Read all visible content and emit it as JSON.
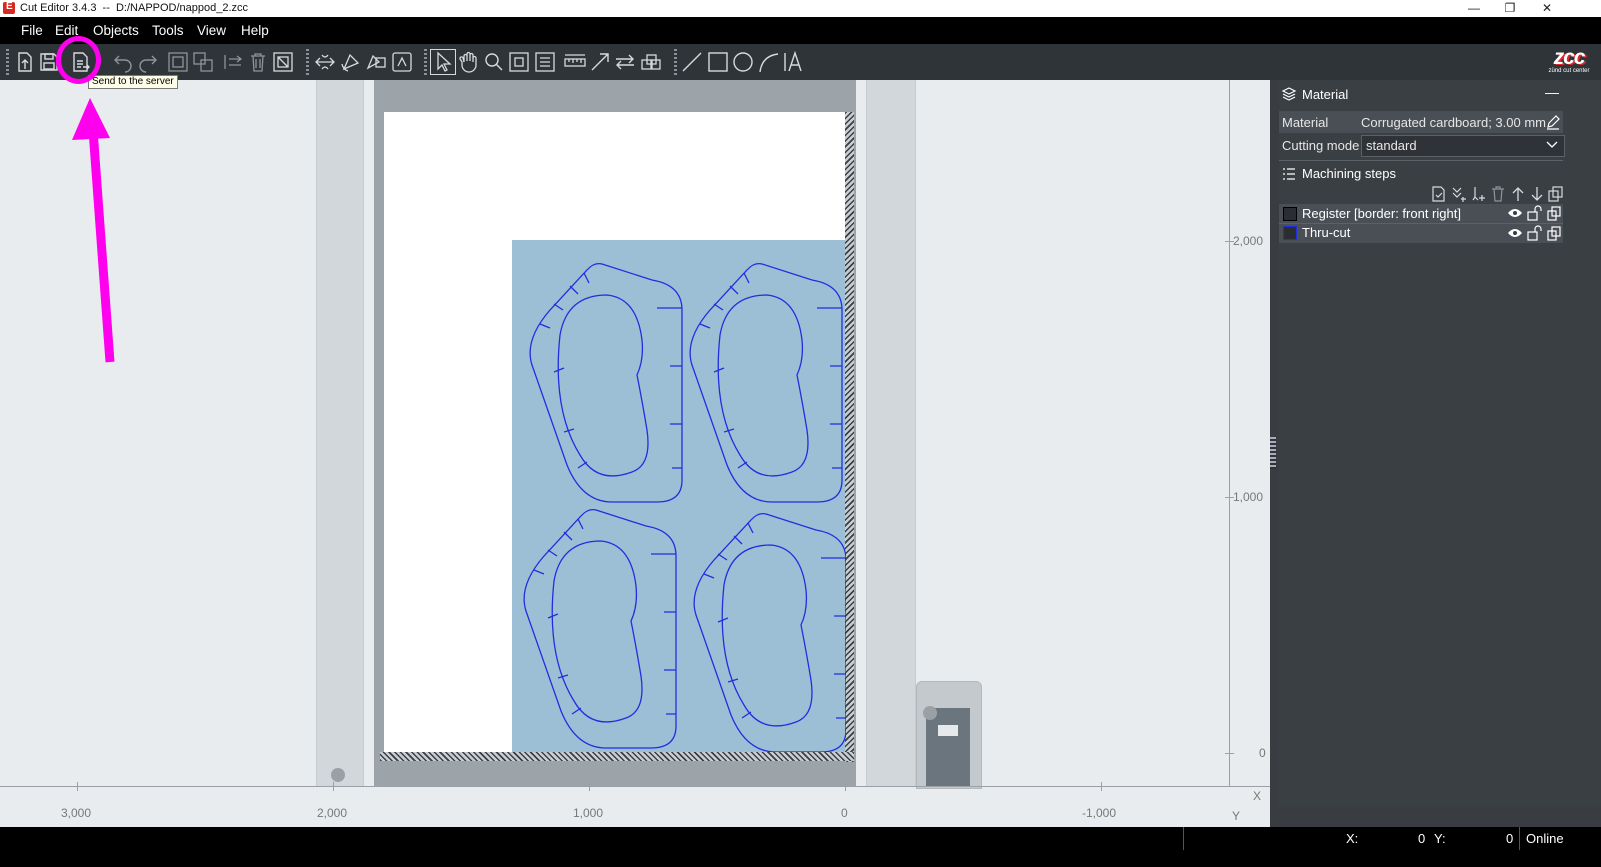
{
  "window": {
    "title": "Cut Editor 3.4.3  --  D:/NAPPOD/nappod_2.zcc",
    "minimize": "—",
    "maximize": "❐",
    "close": "✕"
  },
  "menu": {
    "items": [
      "File",
      "Edit",
      "Objects",
      "Tools",
      "View",
      "Help"
    ]
  },
  "toolbar": {
    "tooltip": "Send to the server",
    "brand": "zcc",
    "brand_sub": "zünd cut center",
    "colors": {
      "icon": "#d7dadd",
      "disabled": "#8d949a",
      "background": "#2f3439"
    }
  },
  "canvas": {
    "ruler_v": [
      "2,000",
      "1,000",
      "0"
    ],
    "ruler_h": [
      "3,000",
      "2,000",
      "1,000",
      "0",
      "-1,000"
    ],
    "axis_x": "X",
    "axis_y": "Y",
    "colors": {
      "sheet": "#9dbfd6",
      "cut_line": "#1f2fe0",
      "bed": "#9ca3a9"
    }
  },
  "panel": {
    "material_section": "Material",
    "collapse": "—",
    "material_label": "Material",
    "material_value": "Corrugated cardboard; 3.00 mm",
    "cutting_mode_label": "Cutting mode",
    "cutting_mode_value": "standard",
    "machining_section": "Machining steps",
    "steps": [
      {
        "label": "Register [border: front right]",
        "color": "#000000"
      },
      {
        "label": "Thru-cut",
        "color": "#1f2fe0"
      }
    ]
  },
  "status": {
    "x_label": "X:",
    "x_value": "0",
    "y_label": "Y:",
    "y_value": "0",
    "connection": "Online"
  },
  "annotation": {
    "color": "#ff00ee"
  }
}
